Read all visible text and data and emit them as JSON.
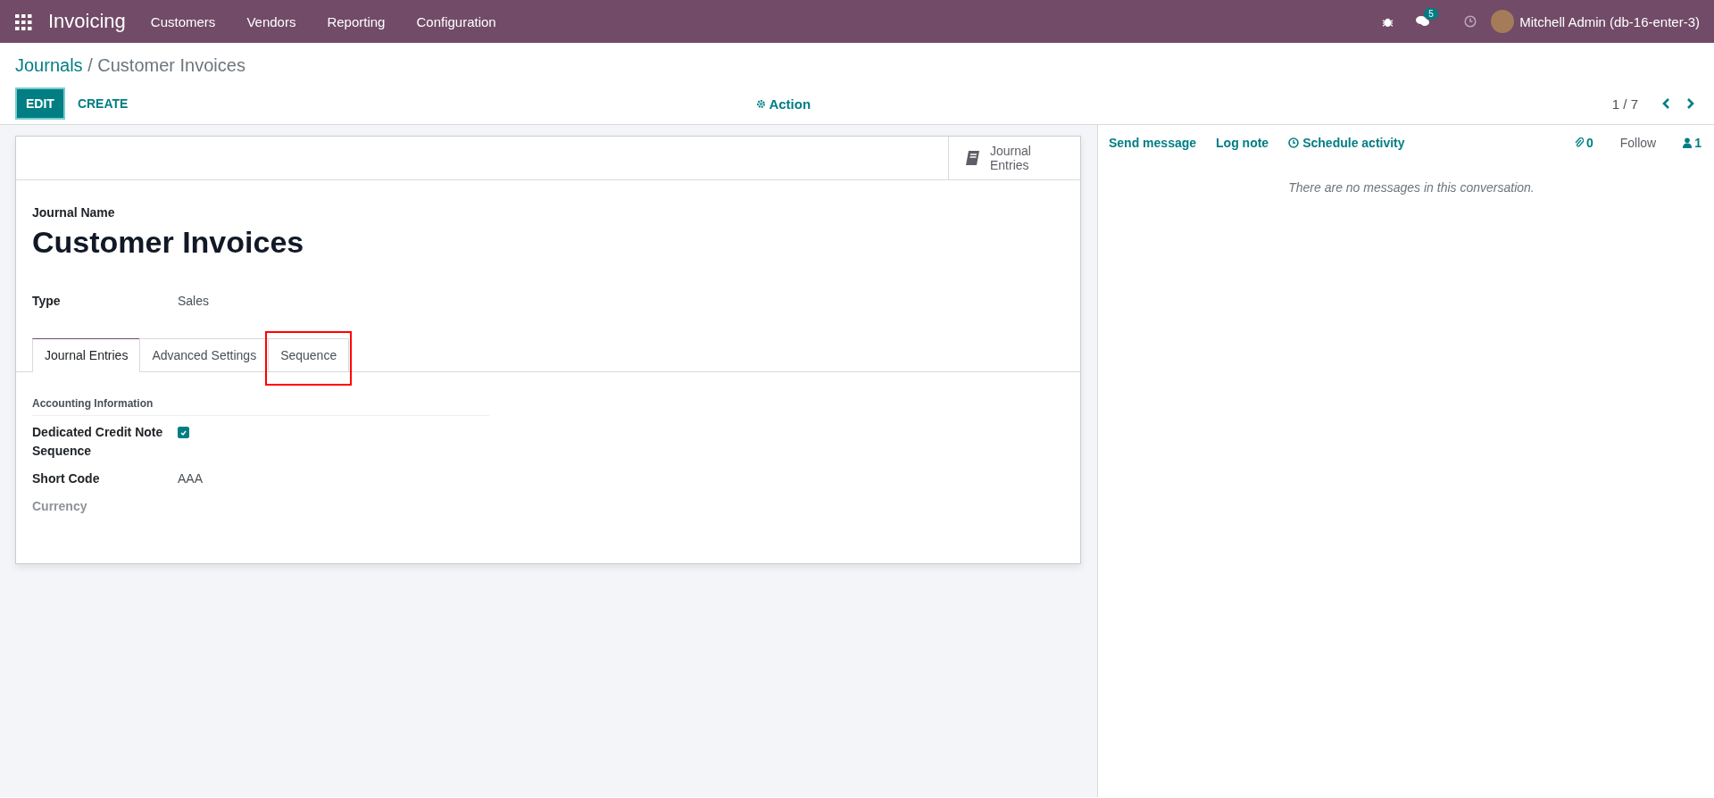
{
  "navbar": {
    "app_name": "Invoicing",
    "menu": [
      "Customers",
      "Vendors",
      "Reporting",
      "Configuration"
    ],
    "messages_badge": "5",
    "user_name": "Mitchell Admin (db-16-enter-3)"
  },
  "breadcrumb": {
    "parent": "Journals",
    "separator": "/",
    "current": "Customer Invoices"
  },
  "buttons": {
    "edit": "EDIT",
    "create": "CREATE",
    "action": "Action"
  },
  "pager": "1 / 7",
  "form": {
    "smart_button": "Journal Entries",
    "name_label": "Journal Name",
    "name": "Customer Invoices",
    "fields": [
      {
        "label": "Type",
        "value": "Sales"
      }
    ],
    "tabs": [
      {
        "label": "Journal Entries",
        "selected": true,
        "highlighted": false
      },
      {
        "label": "Advanced Settings",
        "selected": false,
        "highlighted": false
      },
      {
        "label": "Sequence",
        "selected": false,
        "highlighted": true
      }
    ],
    "section_title": "Accounting Information",
    "tab_fields": [
      {
        "kind": "checkbox",
        "label": "Dedicated Credit Note Sequence",
        "checked": true
      },
      {
        "kind": "text",
        "label": "Short Code",
        "value": "AAA",
        "disabled": false
      },
      {
        "kind": "text",
        "label": "Currency",
        "disabled": true
      }
    ]
  },
  "chatter": {
    "actions": [
      {
        "label": "Send message",
        "icon": false
      },
      {
        "label": "Log note",
        "icon": false
      },
      {
        "label": "Schedule activity",
        "icon": true
      }
    ],
    "attachments": "0",
    "follow": "Follow",
    "followers": "1",
    "empty_message": "There are no messages in this conversation."
  }
}
